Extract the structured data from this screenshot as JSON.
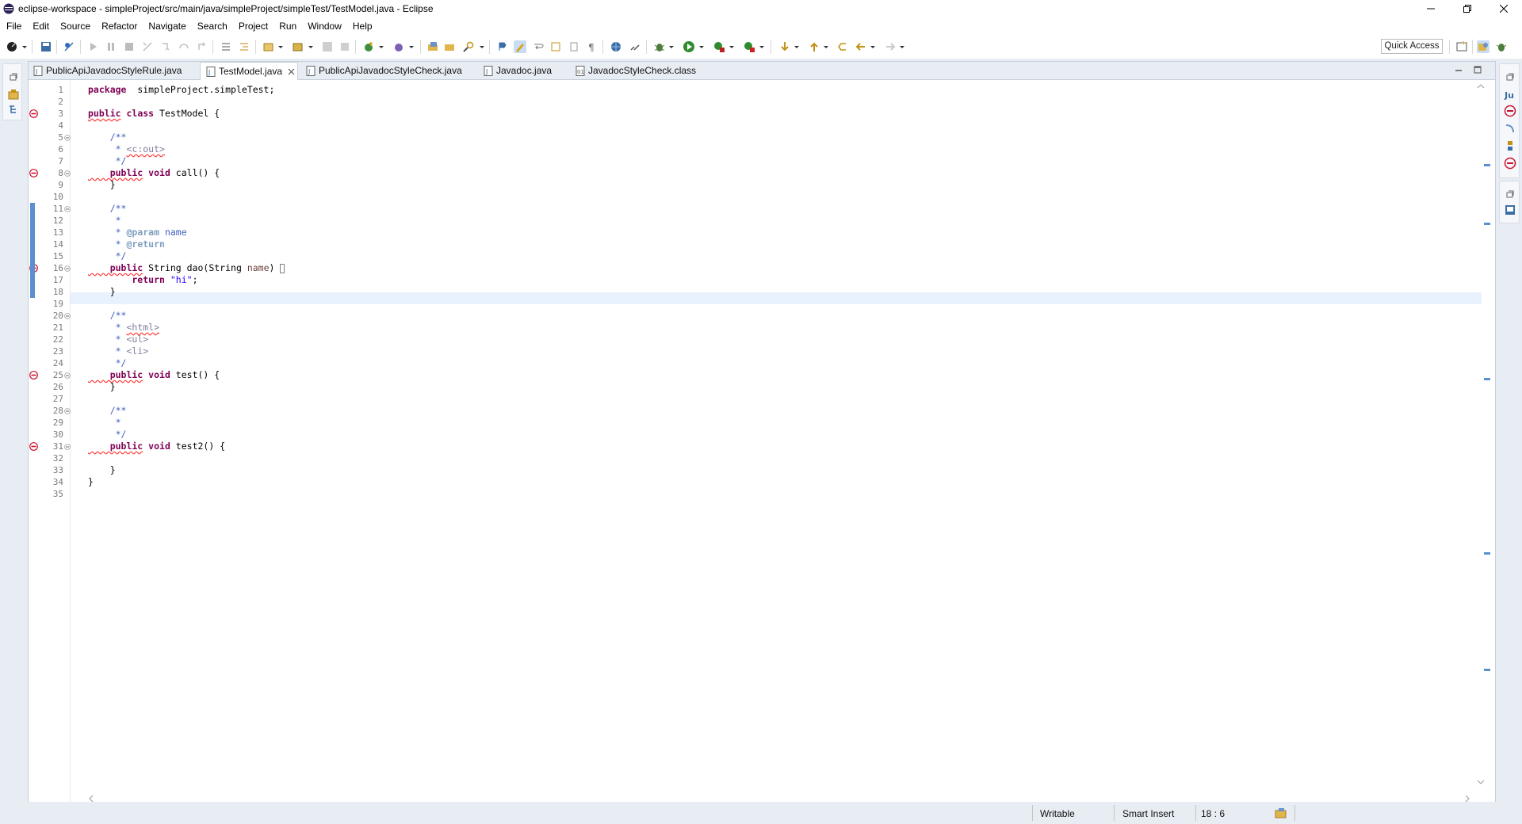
{
  "window": {
    "title": "eclipse-workspace - simpleProject/src/main/java/simpleProject/simpleTest/TestModel.java - Eclipse",
    "controls": {
      "minimize": "–",
      "restore": "❐",
      "close": "✕"
    }
  },
  "menu": [
    "File",
    "Edit",
    "Source",
    "Refactor",
    "Navigate",
    "Search",
    "Project",
    "Run",
    "Window",
    "Help"
  ],
  "toolbar": {
    "quick_access": "Quick Access",
    "icons": [
      "new-icon",
      "save-icon",
      "build-icon",
      "skip-icon",
      "resume-icon",
      "suspend-icon",
      "terminate-icon",
      "disconnect-icon",
      "step-into-icon",
      "step-over-icon",
      "step-return-icon",
      "drop-frame-icon",
      "new-java-project-icon",
      "new-package-icon",
      "new-class-icon",
      "open-type-icon",
      "search-icon",
      "debug-icon",
      "run-icon",
      "coverage-icon",
      "external-tools-icon",
      "back-icon",
      "forward-icon"
    ]
  },
  "tabs": [
    {
      "label": "PublicApiJavadocStyleRule.java",
      "active": false
    },
    {
      "label": "TestModel.java",
      "active": true
    },
    {
      "label": "PublicApiJavadocStyleCheck.java",
      "active": false
    },
    {
      "label": "Javadoc.java",
      "active": false
    },
    {
      "label": "JavadocStyleCheck.class",
      "active": false
    }
  ],
  "code": {
    "line_numbers": [
      "1",
      "2",
      "3",
      "4",
      "5",
      "6",
      "7",
      "8",
      "9",
      "10",
      "11",
      "12",
      "13",
      "14",
      "15",
      "16",
      "17",
      "18",
      "19",
      "20",
      "21",
      "22",
      "23",
      "24",
      "25",
      "26",
      "27",
      "28",
      "29",
      "30",
      "31",
      "32",
      "33",
      "34",
      "35"
    ],
    "lines": [
      [
        [
          "kw",
          "package"
        ],
        [
          "",
          "  simpleProject.simpleTest;"
        ]
      ],
      [],
      [
        [
          "kw squig",
          "public"
        ],
        [
          "",
          ""
        ],
        [
          "kw",
          " class"
        ],
        [
          "",
          " TestModel {"
        ]
      ],
      [],
      [
        [
          "cm",
          "    /**"
        ]
      ],
      [
        [
          "cm",
          "     * "
        ],
        [
          "tag squig",
          "<c:out>"
        ]
      ],
      [
        [
          "cm",
          "     */"
        ]
      ],
      [
        [
          "kw squig",
          "    public"
        ],
        [
          "kw",
          " void"
        ],
        [
          "",
          " call() {"
        ]
      ],
      [
        [
          "",
          "    }"
        ]
      ],
      [],
      [
        [
          "cm",
          "    /**"
        ]
      ],
      [
        [
          "cm",
          "     *"
        ]
      ],
      [
        [
          "cm",
          "     * "
        ],
        [
          "jtag",
          "@param"
        ],
        [
          "cm",
          " name"
        ]
      ],
      [
        [
          "cm",
          "     * "
        ],
        [
          "jtag",
          "@return"
        ]
      ],
      [
        [
          "cm",
          "     */"
        ]
      ],
      [
        [
          "kw squig",
          "    public"
        ],
        [
          "",
          " String dao(String "
        ],
        [
          "pv",
          "name"
        ],
        [
          "",
          ") "
        ]
      ],
      [
        [
          "kw",
          "        return"
        ],
        [
          "str",
          " \"hi\""
        ],
        [
          "",
          ";"
        ]
      ],
      [
        [
          "",
          "    }"
        ]
      ],
      [],
      [
        [
          "cm",
          "    /**"
        ]
      ],
      [
        [
          "cm",
          "     * "
        ],
        [
          "tag squig",
          "<html>"
        ]
      ],
      [
        [
          "cm",
          "     * "
        ],
        [
          "tag",
          "<ul>"
        ]
      ],
      [
        [
          "cm",
          "     * "
        ],
        [
          "tag",
          "<li>"
        ]
      ],
      [
        [
          "cm",
          "     */"
        ]
      ],
      [
        [
          "kw squig",
          "    public"
        ],
        [
          "kw",
          " void"
        ],
        [
          "",
          " test() {"
        ]
      ],
      [
        [
          "",
          "    }"
        ]
      ],
      [],
      [
        [
          "cm",
          "    /**"
        ]
      ],
      [
        [
          "cm",
          "     *"
        ]
      ],
      [
        [
          "cm",
          "     */"
        ]
      ],
      [
        [
          "kw squig",
          "    public"
        ],
        [
          "kw",
          " void"
        ],
        [
          "",
          " test2() {"
        ]
      ],
      [],
      [
        [
          "",
          "    }"
        ]
      ],
      [
        [
          "",
          "}"
        ]
      ],
      []
    ],
    "error_lines": [
      3,
      8,
      16,
      25,
      31
    ],
    "fold_lines": [
      5,
      8,
      11,
      16,
      20,
      25,
      28,
      31
    ]
  },
  "status": {
    "writable": "Writable",
    "insert_mode": "Smart Insert",
    "position": "18 : 6"
  },
  "colors": {
    "keyword": "#7f0055",
    "javadoc": "#3f5fbf",
    "string": "#2a00ff",
    "current_line": "#e8f2fe",
    "change_bar": "#5a8fd0",
    "error": "#c8102e"
  }
}
